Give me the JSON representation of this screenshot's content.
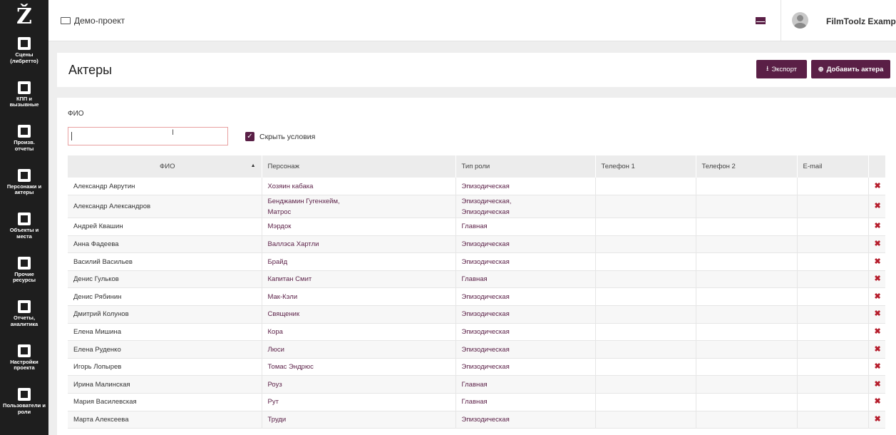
{
  "sidebar": {
    "logo": "Ž",
    "items": [
      {
        "label": "Сцены\n(либретто)",
        "icon": "clapperboard-icon"
      },
      {
        "label": "КПП и\nвызывные",
        "icon": "calendar-icon"
      },
      {
        "label": "Произв.\nотчеты",
        "icon": "checkbox-icon"
      },
      {
        "label": "Персонажи и\nактеры",
        "icon": "users-icon"
      },
      {
        "label": "Объекты и\nместа",
        "icon": "image-icon"
      },
      {
        "label": "Прочие\nресурсы",
        "icon": "archive-icon"
      },
      {
        "label": "Отчеты,\nаналитика",
        "icon": "bar-chart-icon"
      },
      {
        "label": "Настройки\nпроекта",
        "icon": "sliders-icon"
      },
      {
        "label": "Пользователи и\nроли",
        "icon": "users-icon"
      }
    ]
  },
  "topbar": {
    "breadcrumb": "Демо-проект",
    "user_name": "FilmToolz Example"
  },
  "header": {
    "title": "Актеры",
    "export_label": "Экспорт",
    "add_label": "Добавить актера"
  },
  "filter": {
    "label": "ФИО",
    "value": "",
    "hide_conditions_label": "Скрыть условия"
  },
  "table": {
    "columns": [
      "ФИО",
      "Персонаж",
      "Тип роли",
      "Телефон 1",
      "Телефон 2",
      "E-mail"
    ],
    "rows": [
      {
        "fio": "Александр Аврутин",
        "character": "Хозяин кабака",
        "role": "Эпизодическая",
        "phone1": "",
        "phone2": "",
        "email": ""
      },
      {
        "fio": "Александр Александров",
        "character": "Бенджамин Гугенхейм,\nМатрос",
        "role": "Эпизодическая,\nЭпизодическая",
        "phone1": "",
        "phone2": "",
        "email": ""
      },
      {
        "fio": "Андрей Квашин",
        "character": "Мэрдок",
        "role": "Главная",
        "phone1": "",
        "phone2": "",
        "email": ""
      },
      {
        "fio": "Анна Фадеева",
        "character": "Валлэса Хартли",
        "role": "Эпизодическая",
        "phone1": "",
        "phone2": "",
        "email": ""
      },
      {
        "fio": "Василий Васильев",
        "character": "Брайд",
        "role": "Эпизодическая",
        "phone1": "",
        "phone2": "",
        "email": ""
      },
      {
        "fio": "Денис Гульков",
        "character": "Капитан Смит",
        "role": "Главная",
        "phone1": "",
        "phone2": "",
        "email": ""
      },
      {
        "fio": "Денис Рябинин",
        "character": "Мак-Кэли",
        "role": "Эпизодическая",
        "phone1": "",
        "phone2": "",
        "email": ""
      },
      {
        "fio": "Дмитрий Колунов",
        "character": "Священик",
        "role": "Эпизодическая",
        "phone1": "",
        "phone2": "",
        "email": ""
      },
      {
        "fio": "Елена Мишина",
        "character": "Кора",
        "role": "Эпизодическая",
        "phone1": "",
        "phone2": "",
        "email": ""
      },
      {
        "fio": "Елена Руденко",
        "character": "Люси",
        "role": "Эпизодическая",
        "phone1": "",
        "phone2": "",
        "email": ""
      },
      {
        "fio": "Игорь Лопырев",
        "character": "Томас Эндрюс",
        "role": "Эпизодическая",
        "phone1": "",
        "phone2": "",
        "email": ""
      },
      {
        "fio": "Ирина Малинская",
        "character": "Роуз",
        "role": "Главная",
        "phone1": "",
        "phone2": "",
        "email": ""
      },
      {
        "fio": "Мария Василевская",
        "character": "Рут",
        "role": "Главная",
        "phone1": "",
        "phone2": "",
        "email": ""
      },
      {
        "fio": "Марта Алексеева",
        "character": "Труди",
        "role": "Эпизодическая",
        "phone1": "",
        "phone2": "",
        "email": ""
      }
    ]
  },
  "colors": {
    "accent": "#5a1f46",
    "sidebar_bg": "#1e1e1e",
    "delete": "#b51c2b"
  }
}
